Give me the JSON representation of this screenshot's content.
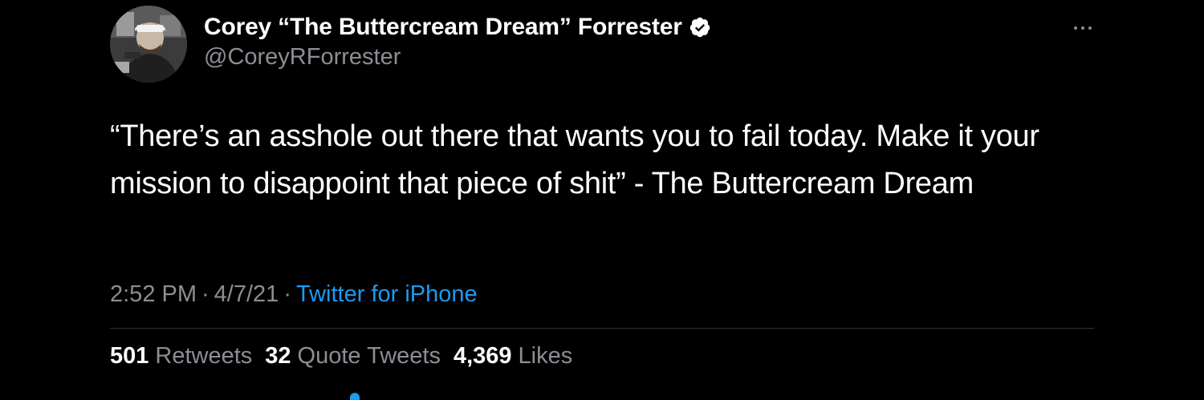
{
  "author": {
    "display_name": "Corey “The Buttercream Dream” Forrester",
    "handle": "@CoreyRForrester",
    "verified": true,
    "avatar_icon": "profile-photo",
    "verified_icon": "verified-badge-icon"
  },
  "tweet": {
    "text": "“There’s an asshole out there that wants you to fail today. Make it your mission to disappoint that piece of shit” - The Buttercream Dream"
  },
  "meta": {
    "time": "2:52 PM",
    "separator": "·",
    "date": "4/7/21",
    "source": "Twitter for iPhone"
  },
  "stats": {
    "retweets_count": "501",
    "retweets_label": "Retweets",
    "quotes_count": "32",
    "quotes_label": "Quote Tweets",
    "likes_count": "4,369",
    "likes_label": "Likes"
  },
  "colors": {
    "background": "#000000",
    "primary_text": "#ffffff",
    "secondary_text": "#8b8f94",
    "link": "#1d9bf0",
    "divider": "#2f3336"
  }
}
